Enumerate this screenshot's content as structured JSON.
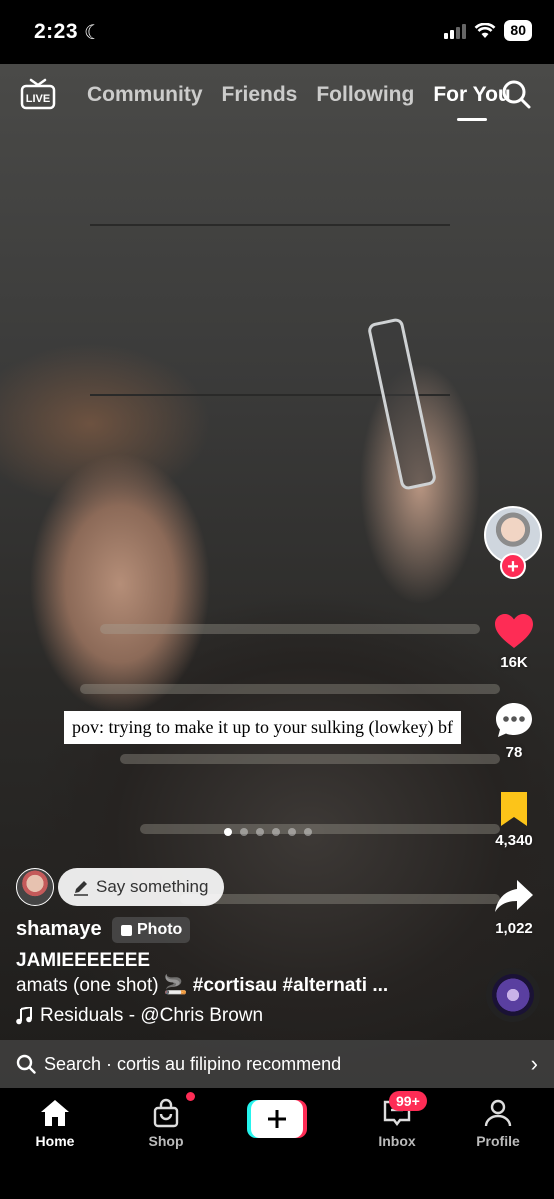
{
  "status_bar": {
    "time": "2:23",
    "moon": "moon-icon",
    "battery": "80"
  },
  "top_nav": {
    "live_label": "LIVE",
    "tabs": [
      {
        "label": "Community",
        "active": false
      },
      {
        "label": "Friends",
        "active": false
      },
      {
        "label": "Following",
        "active": false
      },
      {
        "label": "For You",
        "active": true
      }
    ]
  },
  "post": {
    "sticker_text": "pov: trying to make it up to your sulking (lowkey) bf",
    "slide_count": 6,
    "active_slide": 1,
    "say_something": "Say something",
    "username": "shamaye",
    "badge": "Photo",
    "title": "JAMIEEEEEEE",
    "description": "amats (one shot) 🚬",
    "hashtags": "#cortisau #alternati ...",
    "music": "Residuals - @Chris Brown"
  },
  "rail": {
    "likes": "16K",
    "comments": "78",
    "saves": "4,340",
    "shares": "1,022"
  },
  "search_suggest": {
    "label": "Search · cortis au filipino recommend"
  },
  "tab_bar": {
    "home": "Home",
    "shop": "Shop",
    "inbox": "Inbox",
    "inbox_badge": "99+",
    "profile": "Profile"
  },
  "colors": {
    "accent": "#fe2c55",
    "save": "#fcc419"
  }
}
